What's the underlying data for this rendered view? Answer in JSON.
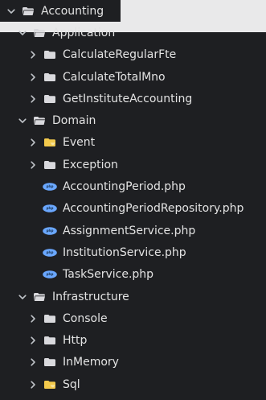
{
  "tree": {
    "root": {
      "label": "Accounting",
      "icon": "folder-open-icon",
      "chevron": "chevron-down-icon"
    },
    "items": [
      {
        "label": "Application",
        "icon": "folder-open-icon",
        "chevron": "chevron-down-icon"
      },
      {
        "label": "CalculateRegularFte",
        "icon": "folder-closed-icon",
        "chevron": "chevron-right-icon"
      },
      {
        "label": "CalculateTotalMno",
        "icon": "folder-closed-icon",
        "chevron": "chevron-right-icon"
      },
      {
        "label": "GetInstituteAccounting",
        "icon": "folder-closed-icon",
        "chevron": "chevron-right-icon"
      },
      {
        "label": "Domain",
        "icon": "folder-open-icon",
        "chevron": "chevron-down-icon"
      },
      {
        "label": "Event",
        "icon": "folder-special-icon",
        "chevron": "chevron-right-icon"
      },
      {
        "label": "Exception",
        "icon": "folder-closed-icon",
        "chevron": "chevron-right-icon"
      },
      {
        "label": "AccountingPeriod.php",
        "icon": "php-file-icon"
      },
      {
        "label": "AccountingPeriodRepository.php",
        "icon": "php-file-icon"
      },
      {
        "label": "AssignmentService.php",
        "icon": "php-file-icon"
      },
      {
        "label": "InstitutionService.php",
        "icon": "php-file-icon"
      },
      {
        "label": "TaskService.php",
        "icon": "php-file-icon"
      },
      {
        "label": "Infrastructure",
        "icon": "folder-open-icon",
        "chevron": "chevron-down-icon"
      },
      {
        "label": "Console",
        "icon": "folder-closed-icon",
        "chevron": "chevron-right-icon"
      },
      {
        "label": "Http",
        "icon": "folder-closed-icon",
        "chevron": "chevron-right-icon"
      },
      {
        "label": "InMemory",
        "icon": "folder-closed-icon",
        "chevron": "chevron-right-icon"
      },
      {
        "label": "Sql",
        "icon": "folder-special-icon",
        "chevron": "chevron-right-icon"
      }
    ]
  },
  "colors": {
    "background": "#1e1f22",
    "top_light": "#e9e9ea",
    "text": "#e3e3e3",
    "chevron": "#bfc3c8",
    "folder": "#d9d9dd",
    "folder_special": "#f2c94c",
    "php": "#6aa7ff"
  }
}
